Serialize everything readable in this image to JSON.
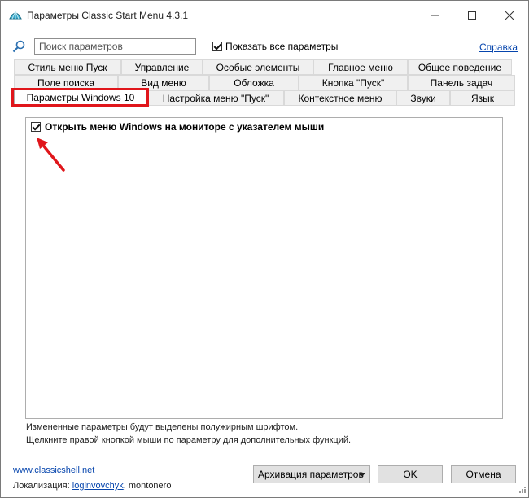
{
  "window": {
    "title": "Параметры Classic Start Menu 4.3.1",
    "minimize_icon": "minimize-icon",
    "maximize_icon": "maximize-icon",
    "close_icon": "close-icon"
  },
  "toolbar": {
    "search_placeholder": "Поиск параметров",
    "show_all_label": "Показать все параметры",
    "show_all_checked": true,
    "help_label": "Справка"
  },
  "tabs": {
    "row1": [
      "Стиль меню Пуск",
      "Управление",
      "Особые элементы",
      "Главное меню",
      "Общее поведение"
    ],
    "row2": [
      "Поле поиска",
      "Вид меню",
      "Обложка",
      "Кнопка \"Пуск\"",
      "Панель задач"
    ],
    "row3": [
      "Параметры Windows 10",
      "Настройка меню \"Пуск\"",
      "Контекстное меню",
      "Звуки",
      "Язык"
    ],
    "active": "Параметры Windows 10"
  },
  "content": {
    "option_label": "Открыть меню Windows на мониторе с указателем мыши",
    "option_checked": true
  },
  "hints": {
    "line1": "Измененные параметры будут выделены полужирным шрифтом.",
    "line2": "Щелкните правой кнопкой мыши по параметру для дополнительных функций."
  },
  "footer": {
    "site_link": "www.classicshell.net",
    "localization_label": "Локализация:",
    "localization_author_link": "loginvovchyk",
    "localization_rest": ", montonero",
    "backup_button": "Архивация параметров",
    "ok_button": "OK",
    "cancel_button": "Отмена"
  },
  "colors": {
    "highlight_red": "#e0161b",
    "link_blue": "#0645ad"
  }
}
